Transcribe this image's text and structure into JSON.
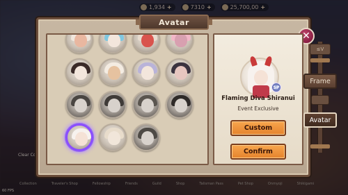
{
  "title": "Avatar",
  "close_glyph": "✕",
  "topbar": [
    {
      "icon": "coin-icon",
      "value": "1,934",
      "plus": "+"
    },
    {
      "icon": "jade-icon",
      "value": "7310",
      "plus": "+"
    },
    {
      "icon": "stamina-icon",
      "value": "25,700,00",
      "plus": "+"
    }
  ],
  "selected_avatar": {
    "name": "Flaming Diva Shiranui",
    "description": "Event Exclusive",
    "badge": "SP"
  },
  "buttons": {
    "custom": "Custom",
    "confirm": "Confirm"
  },
  "side_tabs": {
    "frame": "Frame",
    "avatar": "Avatar",
    "mini": "≤V"
  },
  "avatar_grid": [
    {
      "hair": "#f0e6dc",
      "tint": "#e9b7a0",
      "dark": false
    },
    {
      "hair": "#7fc7e0",
      "tint": "#f3e6dc",
      "dark": false
    },
    {
      "hair": "#e9dccf",
      "tint": "#d9544d",
      "dark": false
    },
    {
      "hair": "#f2b7c7",
      "tint": "#d8a0b0",
      "dark": false
    },
    {
      "hair": "#3a2a28",
      "tint": "#f3e6dc",
      "dark": false
    },
    {
      "hair": "#f4ece2",
      "tint": "#e6c2a0",
      "dark": false
    },
    {
      "hair": "#b9b3d9",
      "tint": "#f3e6dc",
      "dark": false
    },
    {
      "hair": "#3b3340",
      "tint": "#e7c6c0",
      "dark": false
    },
    {
      "hair": "#4a4642",
      "tint": "#d8d2cc",
      "dark": true
    },
    {
      "hair": "#3f3b38",
      "tint": "#d8d2cc",
      "dark": true
    },
    {
      "hair": "#5a554f",
      "tint": "#d8d2cc",
      "dark": true
    },
    {
      "hair": "#2f2b29",
      "tint": "#d8d2cc",
      "dark": true
    },
    {
      "hair": "#f7f2ee",
      "tint": "#f5e2d6",
      "dark": false,
      "selected": true
    },
    {
      "hair": "#e8dccb",
      "tint": "#f1e6da",
      "dark": false
    },
    {
      "hair": "#4e4a45",
      "tint": "#d8d2cc",
      "dark": true
    }
  ],
  "bottom_nav": [
    "Collection",
    "Traveler's Shop",
    "Fellowship",
    "Friends",
    "Guild",
    "Shop",
    "Talisman Pass",
    "Pet Shop",
    "Onmyoji",
    "Shikigami"
  ],
  "clear_label": "Clear Co",
  "fps_label": "60 FPS"
}
